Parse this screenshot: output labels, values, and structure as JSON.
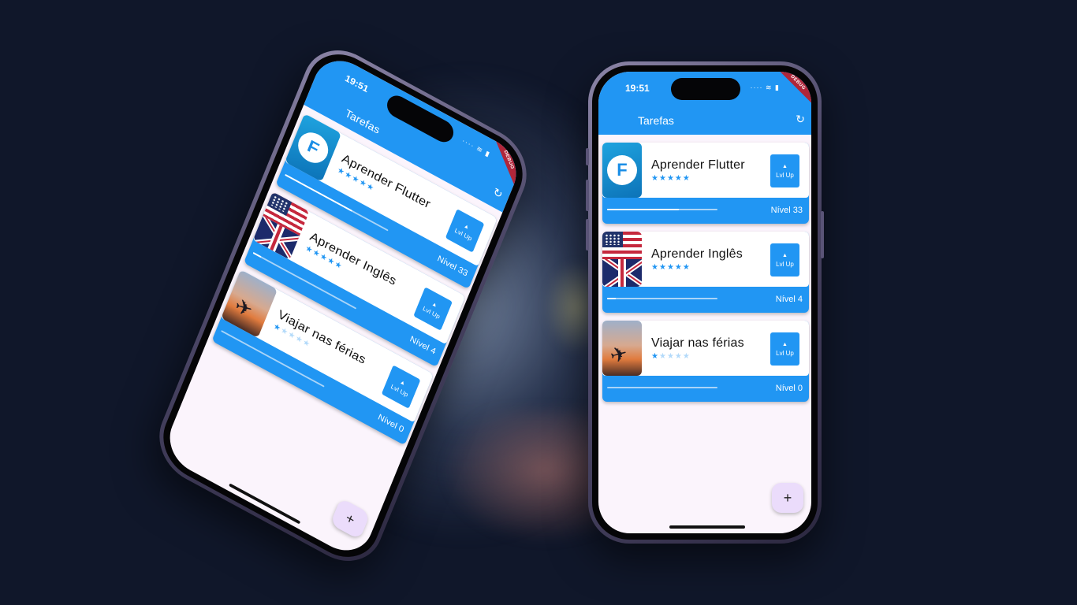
{
  "app": {
    "status_time": "19:51",
    "status_icons": "····  ≋  ▮",
    "title": "Tarefas",
    "debug_label": "DEBUG"
  },
  "tasks": [
    {
      "name": "Aprender Flutter",
      "level_text": "Nível 33",
      "lvl_button": "Lvl Up",
      "difficulty_stars": 5,
      "progress": 0.65,
      "image": "flutter-logo-icon"
    },
    {
      "name": "Aprender Inglês",
      "level_text": "Nível 4",
      "lvl_button": "Lvl Up",
      "difficulty_stars": 5,
      "progress": 0.08,
      "image": "flag-icon"
    },
    {
      "name": "Viajar nas férias",
      "level_text": "Nível 0",
      "lvl_button": "Lvl Up",
      "difficulty_stars": 1,
      "progress": 0.0,
      "image": "airplane-icon"
    }
  ],
  "stars": {
    "on": "★",
    "off": "★",
    "total": 5
  },
  "fab": {
    "label": "+"
  },
  "icons": {
    "refresh": "↻",
    "flutter": "F",
    "arrow_up": "▲",
    "plane": "✈"
  },
  "colors": {
    "primary": "#2196f3",
    "background": "#10172a",
    "fab": "#ebdcfb"
  }
}
